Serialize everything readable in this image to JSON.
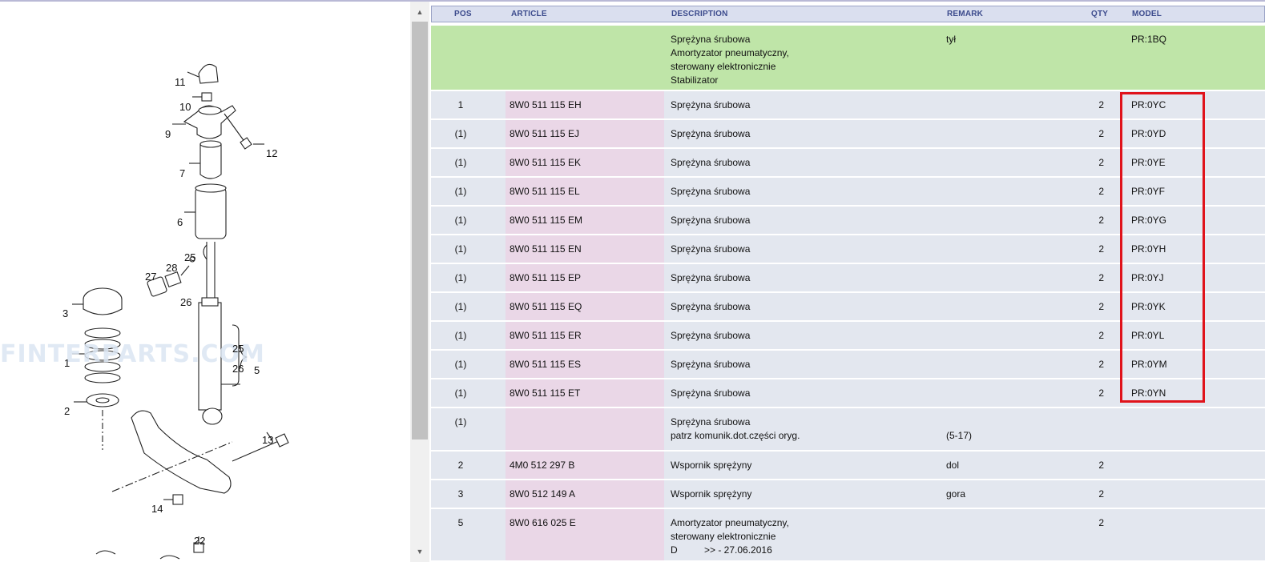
{
  "watermark": "FINTERPARTS.COM",
  "diagram": {
    "callouts": [
      "11",
      "10",
      "9",
      "12",
      "7",
      "6",
      "25",
      "28",
      "27",
      "26",
      "3",
      "1",
      "2",
      "25",
      "26",
      "5",
      "13",
      "14",
      "22"
    ]
  },
  "scrollbar": {
    "up_icon": "chevron-up-icon",
    "down_icon": "chevron-down-icon"
  },
  "table": {
    "headers": {
      "pos": "POS",
      "article": "ARTICLE",
      "description": "DESCRIPTION",
      "remark": "REMARK",
      "qty": "QTY",
      "model": "MODEL"
    },
    "rows": [
      {
        "pos": "",
        "article": "",
        "description": "Sprężyna śrubowa\nAmortyzator pneumatyczny,\nsterowany elektronicznie\nStabilizator",
        "remark": "tył",
        "qty": "",
        "model": "PR:1BQ"
      },
      {
        "pos": "1",
        "article": "8W0 511 115 EH",
        "description": "Sprężyna śrubowa",
        "remark": "",
        "qty": "2",
        "model": "PR:0YC"
      },
      {
        "pos": "(1)",
        "article": "8W0 511 115 EJ",
        "description": "Sprężyna śrubowa",
        "remark": "",
        "qty": "2",
        "model": "PR:0YD"
      },
      {
        "pos": "(1)",
        "article": "8W0 511 115 EK",
        "description": "Sprężyna śrubowa",
        "remark": "",
        "qty": "2",
        "model": "PR:0YE"
      },
      {
        "pos": "(1)",
        "article": "8W0 511 115 EL",
        "description": "Sprężyna śrubowa",
        "remark": "",
        "qty": "2",
        "model": "PR:0YF"
      },
      {
        "pos": "(1)",
        "article": "8W0 511 115 EM",
        "description": "Sprężyna śrubowa",
        "remark": "",
        "qty": "2",
        "model": "PR:0YG"
      },
      {
        "pos": "(1)",
        "article": "8W0 511 115 EN",
        "description": "Sprężyna śrubowa",
        "remark": "",
        "qty": "2",
        "model": "PR:0YH"
      },
      {
        "pos": "(1)",
        "article": "8W0 511 115 EP",
        "description": "Sprężyna śrubowa",
        "remark": "",
        "qty": "2",
        "model": "PR:0YJ"
      },
      {
        "pos": "(1)",
        "article": "8W0 511 115 EQ",
        "description": "Sprężyna śrubowa",
        "remark": "",
        "qty": "2",
        "model": "PR:0YK"
      },
      {
        "pos": "(1)",
        "article": "8W0 511 115 ER",
        "description": "Sprężyna śrubowa",
        "remark": "",
        "qty": "2",
        "model": "PR:0YL"
      },
      {
        "pos": "(1)",
        "article": "8W0 511 115 ES",
        "description": "Sprężyna śrubowa",
        "remark": "",
        "qty": "2",
        "model": "PR:0YM"
      },
      {
        "pos": "(1)",
        "article": "8W0 511 115 ET",
        "description": "Sprężyna śrubowa",
        "remark": "",
        "qty": "2",
        "model": "PR:0YN"
      },
      {
        "pos": "(1)",
        "article": "",
        "description": "Sprężyna śrubowa\npatrz komunik.dot.części oryg.",
        "remark": "\n(5-17)",
        "qty": "",
        "model": ""
      },
      {
        "pos": "2",
        "article": "4M0 512 297 B",
        "description": "Wspornik sprężyny",
        "remark": "dol",
        "qty": "2",
        "model": ""
      },
      {
        "pos": "3",
        "article": "8W0 512 149 A",
        "description": "Wspornik sprężyny",
        "remark": "gora",
        "qty": "2",
        "model": ""
      },
      {
        "pos": "5",
        "article": "8W0 616 025 E",
        "description": "Amortyzator pneumatyczny,\nsterowany elektronicznie\nD          >> - 27.06.2016",
        "remark": "",
        "qty": "2",
        "model": ""
      }
    ]
  },
  "colors": {
    "header_bg": "#dadfef",
    "row_bg": "#e3e7ef",
    "article_bg": "#ead7e7",
    "highlight_row": "#bfe5a8",
    "red_box": "#e0131b"
  }
}
